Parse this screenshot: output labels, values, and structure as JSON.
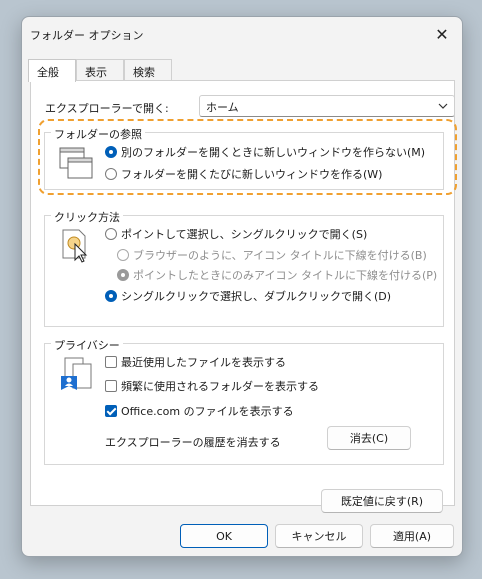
{
  "window": {
    "title": "フォルダー オプション"
  },
  "tabs": [
    {
      "label": "全般",
      "active": true
    },
    {
      "label": "表示",
      "active": false
    },
    {
      "label": "検索",
      "active": false
    }
  ],
  "open_explorer": {
    "label": "エクスプローラーで開く:",
    "value": "ホーム"
  },
  "browse_folders": {
    "title": "フォルダーの参照",
    "options": [
      {
        "label": "別のフォルダーを開くときに新しいウィンドウを作らない(M)",
        "selected": true
      },
      {
        "label": "フォルダーを開くたびに新しいウィンドウを作る(W)",
        "selected": false
      }
    ]
  },
  "click_method": {
    "title": "クリック方法",
    "options": [
      {
        "label": "ポイントして選択し、シングルクリックで開く(S)",
        "selected": false,
        "enabled": true
      },
      {
        "label": "ブラウザーのように、アイコン タイトルに下線を付ける(B)",
        "selected": false,
        "enabled": false
      },
      {
        "label": "ポイントしたときにのみアイコン タイトルに下線を付ける(P)",
        "selected": true,
        "enabled": false
      },
      {
        "label": "シングルクリックで選択し、ダブルクリックで開く(D)",
        "selected": true,
        "enabled": true
      }
    ]
  },
  "privacy": {
    "title": "プライバシー",
    "checks": [
      {
        "label": "最近使用したファイルを表示する",
        "checked": false
      },
      {
        "label": "頻繁に使用されるフォルダーを表示する",
        "checked": false
      },
      {
        "label": "Office.com のファイルを表示する",
        "checked": true
      }
    ],
    "clear_history_label": "エクスプローラーの履歴を消去する",
    "clear_button": "消去(C)"
  },
  "restore_defaults": "既定値に戻す(R)",
  "footer": {
    "ok": "OK",
    "cancel": "キャンセル",
    "apply": "適用(A)"
  },
  "colors": {
    "accent": "#005fb8",
    "highlight": "#f0a030"
  }
}
